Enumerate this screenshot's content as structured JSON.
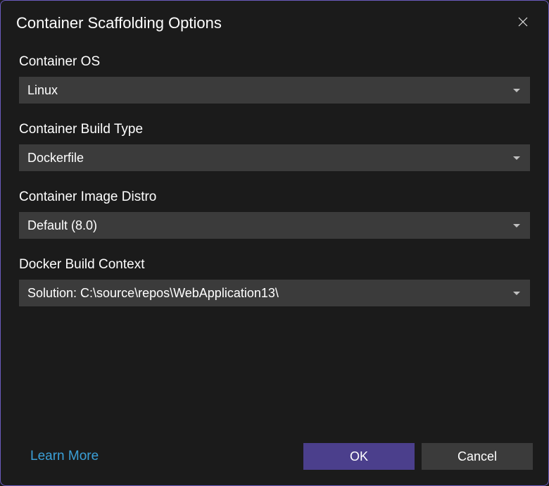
{
  "dialog": {
    "title": "Container Scaffolding Options"
  },
  "fields": {
    "os": {
      "label": "Container OS",
      "value": "Linux"
    },
    "buildType": {
      "label": "Container Build Type",
      "value": "Dockerfile"
    },
    "imageDistro": {
      "label": "Container Image Distro",
      "value": "Default (8.0)"
    },
    "buildContext": {
      "label": "Docker Build Context",
      "value": "Solution: C:\\source\\repos\\WebApplication13\\"
    }
  },
  "footer": {
    "learnMore": "Learn More",
    "ok": "OK",
    "cancel": "Cancel"
  }
}
